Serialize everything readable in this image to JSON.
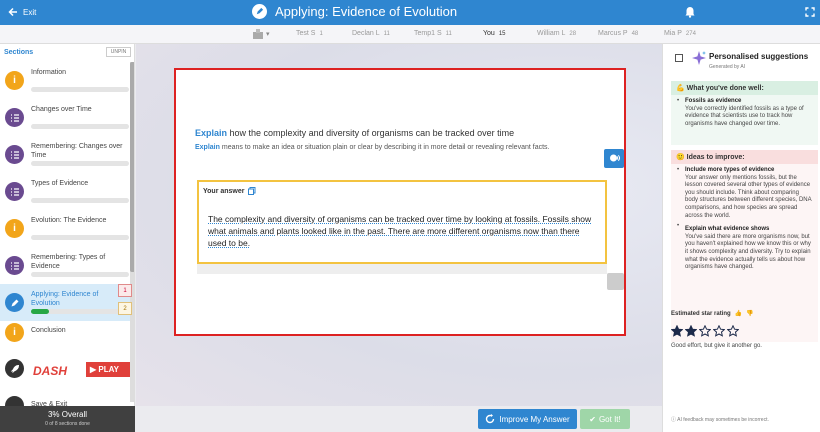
{
  "topbar": {
    "exit_label": "Exit",
    "title": "Applying: Evidence of Evolution"
  },
  "students": [
    {
      "name": "Test S",
      "count": "1"
    },
    {
      "name": "Declan L",
      "count": "11"
    },
    {
      "name": "Temp1 S",
      "count": "11"
    },
    {
      "name": "You",
      "count": "15"
    },
    {
      "name": "William L",
      "count": "28"
    },
    {
      "name": "Marcus P",
      "count": "48"
    },
    {
      "name": "Mia P",
      "count": "274"
    }
  ],
  "sidebar": {
    "heading": "Sections",
    "unpin_label": "UNPIN",
    "sections": [
      {
        "label": "Information",
        "icon": "info-icon",
        "progress": 0
      },
      {
        "label": "Changes over Time",
        "icon": "list-icon",
        "progress": 0
      },
      {
        "label": "Remembering: Changes over Time",
        "icon": "list-icon",
        "progress": 0
      },
      {
        "label": "Types of Evidence",
        "icon": "list-icon",
        "progress": 0
      },
      {
        "label": "Evolution: The Evidence",
        "icon": "info-icon",
        "progress": 0
      },
      {
        "label": "Remembering: Types of Evidence",
        "icon": "list-icon",
        "progress": 0
      },
      {
        "label": "Applying: Evidence of Evolution",
        "icon": "pencil-icon",
        "progress": 0.18,
        "active": true
      },
      {
        "label": "Conclusion",
        "icon": "info-icon",
        "progress": 0
      }
    ],
    "dash_logo": "DASH",
    "play_label": "PLAY",
    "save_label": "Save & Exit",
    "markers": [
      "1",
      "2"
    ],
    "overall_percent": "3% Overall",
    "sections_done": "0 of 8 sections done"
  },
  "question": {
    "keyword": "Explain",
    "prompt": "how the complexity and diversity of organisms can be tracked over time",
    "definition_keyword": "Explain",
    "definition": "means to make an idea or situation plain or clear by describing it in more detail or revealing relevant facts."
  },
  "answer": {
    "label": "Your answer",
    "text": "The complexity and diversity of organisms can be tracked over time by looking at fossils. Fossils show what animals and plants looked like in the past. There are more different organisms now than there used to be."
  },
  "buttons": {
    "improve": "Improve My Answer",
    "got_it": "Got It!"
  },
  "panel": {
    "title": "Personalised suggestions",
    "subtitle": "Generated by AI",
    "good_heading": "What you've done well:",
    "good": [
      {
        "title": "Fossils as evidence",
        "body": "You've correctly identified fossils as a type of evidence that scientists use to track how organisms have changed over time."
      }
    ],
    "ideas_heading": "Ideas to improve:",
    "ideas": [
      {
        "title": "Include more types of evidence",
        "body": "Your answer only mentions fossils, but the lesson covered several other types of evidence you should include. Think about comparing body structures between different species, DNA comparisons, and how species are spread across the world."
      },
      {
        "title": "Explain what evidence shows",
        "body": "You've said there are more organisms now, but you haven't explained how we know this or why it shows complexity and diversity. Try to explain what the evidence actually tells us about how organisms have changed."
      }
    ],
    "rating_label": "Estimated star rating",
    "rating": 2,
    "rating_max": 5,
    "rating_message": "Good effort, but give it another go.",
    "disclaimer": "AI feedback may sometimes be incorrect."
  },
  "colors": {
    "brand": "#2f86d0",
    "card_border": "#dd2222",
    "answer_border": "#f3c340"
  }
}
